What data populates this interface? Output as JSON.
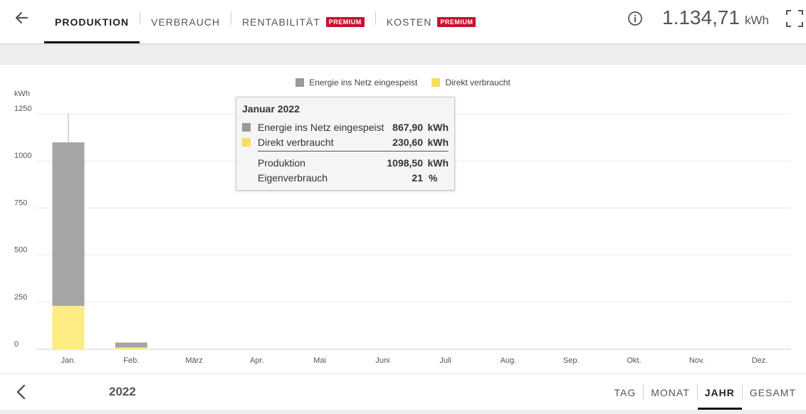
{
  "header": {
    "tabs": [
      {
        "label": "PRODUKTION",
        "active": true,
        "badge": ""
      },
      {
        "label": "VERBRAUCH",
        "active": false,
        "badge": ""
      },
      {
        "label": "RENTABILITÄT",
        "active": false,
        "badge": "PREMIUM"
      },
      {
        "label": "KOSTEN",
        "active": false,
        "badge": "PREMIUM"
      }
    ],
    "total_value": "1.134,71",
    "total_unit": "kWh",
    "icons": {
      "back": "arrow-left-icon",
      "info": "info-icon",
      "fullscreen": "fullscreen-icon"
    }
  },
  "colors": {
    "grid_feed": "#a6a6a6",
    "self_consumed": "#fcec83",
    "badge": "#c8102e",
    "tooltip_bar_gray": "#999999",
    "tooltip_bar_yellow": "#f8dc5e"
  },
  "legend": {
    "grid_feed": "Energie ins Netz eingespeist",
    "self_consumed": "Direkt verbraucht"
  },
  "tooltip": {
    "title": "Januar 2022",
    "rows": [
      {
        "label": "Energie ins Netz eingespeist",
        "value": "867,90",
        "unit": "kWh"
      },
      {
        "label": "Direkt verbraucht",
        "value": "230,60",
        "unit": "kWh"
      }
    ],
    "summary": [
      {
        "label": "Produktion",
        "value": "1098,50",
        "unit": "kWh"
      },
      {
        "label": "Eigenverbrauch",
        "value": "21",
        "unit": "%"
      }
    ]
  },
  "chart_data": {
    "type": "bar",
    "stacked": true,
    "ylabel": "kWh",
    "ylim": [
      0,
      1250
    ],
    "yticks": [
      0,
      250,
      500,
      750,
      1000,
      1250
    ],
    "grid": true,
    "legend_position": "top-center",
    "categories": [
      "Jan.",
      "Feb.",
      "März",
      "Apr.",
      "Mai",
      "Juni",
      "Juli",
      "Aug.",
      "Sep.",
      "Okt.",
      "Nov.",
      "Dez."
    ],
    "series": [
      {
        "name": "Direkt verbraucht",
        "color": "#fcec83",
        "values": [
          230.6,
          9,
          0,
          0,
          0,
          0,
          0,
          0,
          0,
          0,
          0,
          0
        ]
      },
      {
        "name": "Energie ins Netz eingespeist",
        "color": "#a6a6a6",
        "values": [
          867.9,
          27,
          0,
          0,
          0,
          0,
          0,
          0,
          0,
          0,
          0,
          0
        ]
      }
    ]
  },
  "footer": {
    "year": "2022",
    "periods": [
      {
        "label": "TAG",
        "active": false
      },
      {
        "label": "MONAT",
        "active": false
      },
      {
        "label": "JAHR",
        "active": true
      },
      {
        "label": "GESAMT",
        "active": false
      }
    ],
    "icons": {
      "prev": "chevron-left-icon"
    }
  }
}
